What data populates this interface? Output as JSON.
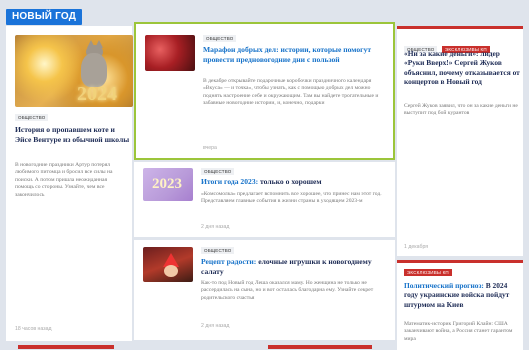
{
  "section": {
    "label": "НОВЫЙ ГОД"
  },
  "cards": [
    {
      "tag": "Общество",
      "image_text": "2024",
      "title": "История о пропавшем коте и Эйсе Вентуре из обычной школы",
      "excerpt": "В новогодние праздники Артур потерял любимого питомца и бросил все силы на поиски. А потом пришла неожиданная помощь со стороны. Узнайте, чем все закончилось",
      "time": "18 часов назад"
    },
    {
      "tag": "Общество",
      "title": "Марафон добрых дел: истории, которые помогут провести предновогодние дни с пользой",
      "excerpt": "В декабре открывайте подарочные коробочки праздничного календаря «Вкуса» — и точка», чтобы узнать, как с помощью добрых дел можно поднять настроение себе и окружающим. Там вы найдете трогательные и забавные новогодние истории, и, конечно, подарки",
      "time": "вчера"
    },
    {
      "tag": "Общество",
      "image_text": "2023",
      "title_accent": "Итоги года 2023:",
      "title_rest": " только о хорошем",
      "excerpt": "«Комсомолка» предлагает вспомнить все хорошее, что принес нам этот год. Представляем главные события в жизни страны в уходящем 2023-м",
      "time": "2 дня назад"
    },
    {
      "tag": "Общество",
      "title_accent": "Рецепт радости:",
      "title_rest": " елочные игрушки к новогоднему салату",
      "excerpt": "Как-то под Новый год Леша оказался маму. Но женщина не только не рассердилась на сына, но и вот осталась благодарна ему. Узнайте секрет родительского счастья",
      "time": "2 дня назад"
    },
    {
      "tags": [
        "Общество",
        "Эксклюзивы КП"
      ],
      "title": "«Ни за какие деньги»: лидер «Руки Вверх!» Сергей Жуков объяснил, почему отказывается от концертов в Новый год",
      "excerpt": "Сергей Жуков заявил, что он за какие деньги не выступит под бой курантов",
      "time": "1 декабря"
    },
    {
      "tag": "Эксклюзивы КП",
      "title_accent": "Политический прогноз:",
      "title_rest": " В 2024 году украинские войска пойдут штурмом на Киев",
      "excerpt": "Математик-историк Григорий Клайн: США заканчивают война, а Россия станет гарантом мира"
    }
  ]
}
